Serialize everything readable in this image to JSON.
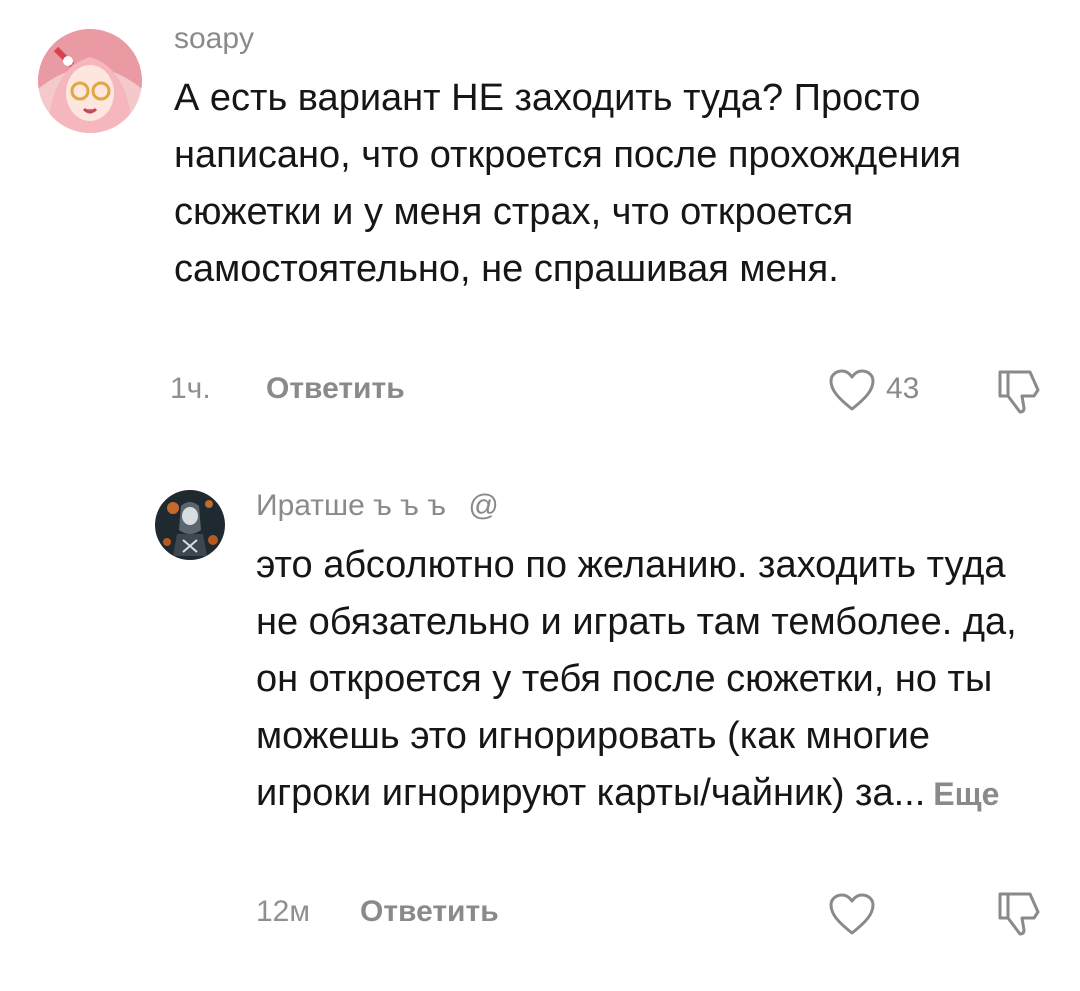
{
  "comments": [
    {
      "username": "soapy",
      "avatar_icon": "anime-girl-avatar",
      "text": "А есть вариант НЕ заходить туда? Просто написано, что откроется после прохождения сюжетки и у меня страх, что откроется самостоятельно, не спрашивая меня.",
      "time": "1ч.",
      "reply_label": "Ответить",
      "likes": "43",
      "like_icon": "heart-icon",
      "dislike_icon": "thumbs-down-icon"
    },
    {
      "username": "Иратше ъ ъ ъ",
      "username_suffix": "@",
      "avatar_icon": "dark-character-avatar",
      "text": "это абсолютно по желанию. заходить туда не обязательно и играть там темболее. да, он откроется у тебя после сюжетки, но ты можешь это игнорировать (как многие игроки игнорируют карты/чайник) за...",
      "more_label": "Еще",
      "time": "12м",
      "reply_label": "Ответить",
      "like_icon": "heart-icon",
      "dislike_icon": "thumbs-down-icon"
    }
  ],
  "colors": {
    "text": "#161616",
    "muted": "#8a8a8a",
    "background": "#ffffff"
  }
}
